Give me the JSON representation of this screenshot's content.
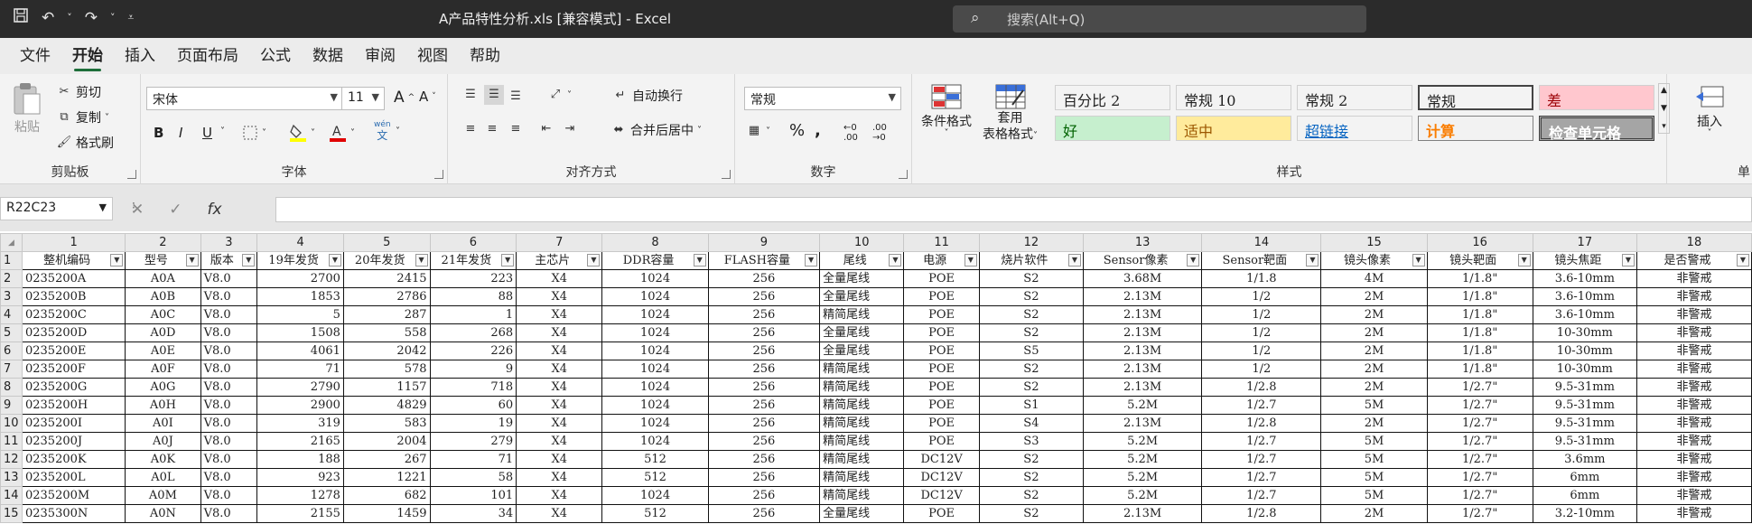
{
  "app": {
    "title": "A产品特性分析.xls  [兼容模式]  -  Excel",
    "search_placeholder": "搜索(Alt+Q)"
  },
  "menu": [
    "文件",
    "开始",
    "插入",
    "页面布局",
    "公式",
    "数据",
    "审阅",
    "视图",
    "帮助"
  ],
  "ribbon": {
    "clipboard": {
      "label": "剪贴板",
      "paste": "粘贴",
      "cut": "剪切",
      "copy": "复制",
      "format_painter": "格式刷"
    },
    "font": {
      "label": "字体",
      "family": "宋体",
      "size": "11",
      "grow": "A^",
      "shrink": "A˅",
      "bold": "B",
      "italic": "I",
      "underline": "U",
      "wen": "wén",
      "wen2": "文"
    },
    "alignment": {
      "label": "对齐方式",
      "wrap": "自动换行",
      "merge": "合并后居中"
    },
    "number": {
      "label": "数字",
      "format": "常规"
    },
    "styles": {
      "label": "样式",
      "conditional": "条件格式",
      "table1": "套用",
      "table2": "表格格式",
      "cells": [
        {
          "text": "百分比 2",
          "bg": "#ffffff",
          "color": "#000000"
        },
        {
          "text": "常规 10",
          "bg": "#ffffff",
          "color": "#000000"
        },
        {
          "text": "常规 2",
          "bg": "#ffffff",
          "color": "#000000"
        },
        {
          "text": "常规",
          "bg": "#ffffff",
          "color": "#000000"
        },
        {
          "text": "差",
          "bg": "#ffc7ce",
          "color": "#9c0006"
        },
        {
          "text": "好",
          "bg": "#c6efce",
          "color": "#006100"
        },
        {
          "text": "适中",
          "bg": "#ffeb9c",
          "color": "#9c5700"
        },
        {
          "text": "超链接",
          "bg": "#ffffff",
          "color": "#0563c1"
        },
        {
          "text": "计算",
          "bg": "#f2f2f2",
          "color": "#fa7d00"
        },
        {
          "text": "检查单元格",
          "bg": "#a5a5a5",
          "color": "#ffffff"
        }
      ]
    },
    "cells_group": {
      "insert": "插入",
      "label": "单"
    }
  },
  "formula_bar": {
    "name_box": "R22C23",
    "fx": "fx",
    "value": ""
  },
  "sheet": {
    "col_numbers": [
      "1",
      "2",
      "3",
      "4",
      "5",
      "6",
      "7",
      "8",
      "9",
      "10",
      "11",
      "12",
      "13",
      "14",
      "15",
      "16",
      "17",
      "18"
    ],
    "headers": [
      "整机编码",
      "型号",
      "版本",
      "19年发货",
      "20年发货",
      "21年发货",
      "主芯片",
      "DDR容量",
      "FLASH容量",
      "尾线",
      "电源",
      "烧片软件",
      "Sensor像素",
      "Sensor靶面",
      "镜头像素",
      "镜头靶面",
      "镜头焦距",
      "是否警戒"
    ],
    "rows": [
      [
        "0235200A",
        "A0A",
        "V8.0",
        "2700",
        "2415",
        "223",
        "X4",
        "1024",
        "256",
        "全量尾线",
        "POE",
        "S2",
        "3.68M",
        "1/1.8",
        "4M",
        "1/1.8\"",
        "3.6-10mm",
        "非警戒"
      ],
      [
        "0235200B",
        "A0B",
        "V8.0",
        "1853",
        "2786",
        "88",
        "X4",
        "1024",
        "256",
        "全量尾线",
        "POE",
        "S2",
        "2.13M",
        "1/2",
        "2M",
        "1/1.8\"",
        "3.6-10mm",
        "非警戒"
      ],
      [
        "0235200C",
        "A0C",
        "V8.0",
        "5",
        "287",
        "1",
        "X4",
        "1024",
        "256",
        "精简尾线",
        "POE",
        "S2",
        "2.13M",
        "1/2",
        "2M",
        "1/1.8\"",
        "3.6-10mm",
        "非警戒"
      ],
      [
        "0235200D",
        "A0D",
        "V8.0",
        "1508",
        "558",
        "268",
        "X4",
        "1024",
        "256",
        "全量尾线",
        "POE",
        "S2",
        "2.13M",
        "1/2",
        "2M",
        "1/1.8\"",
        "10-30mm",
        "非警戒"
      ],
      [
        "0235200E",
        "A0E",
        "V8.0",
        "4061",
        "2042",
        "226",
        "X4",
        "1024",
        "256",
        "全量尾线",
        "POE",
        "S5",
        "2.13M",
        "1/2",
        "2M",
        "1/1.8\"",
        "10-30mm",
        "非警戒"
      ],
      [
        "0235200F",
        "A0F",
        "V8.0",
        "71",
        "578",
        "9",
        "X4",
        "1024",
        "256",
        "精简尾线",
        "POE",
        "S2",
        "2.13M",
        "1/2",
        "2M",
        "1/1.8\"",
        "10-30mm",
        "非警戒"
      ],
      [
        "0235200G",
        "A0G",
        "V8.0",
        "2790",
        "1157",
        "718",
        "X4",
        "1024",
        "256",
        "精简尾线",
        "POE",
        "S2",
        "2.13M",
        "1/2.8",
        "2M",
        "1/2.7\"",
        "9.5-31mm",
        "非警戒"
      ],
      [
        "0235200H",
        "A0H",
        "V8.0",
        "2900",
        "4829",
        "60",
        "X4",
        "1024",
        "256",
        "精简尾线",
        "POE",
        "S1",
        "5.2M",
        "1/2.7",
        "5M",
        "1/2.7\"",
        "9.5-31mm",
        "非警戒"
      ],
      [
        "0235200I",
        "A0I",
        "V8.0",
        "319",
        "583",
        "19",
        "X4",
        "1024",
        "256",
        "精简尾线",
        "POE",
        "S4",
        "2.13M",
        "1/2.8",
        "2M",
        "1/2.7\"",
        "9.5-31mm",
        "非警戒"
      ],
      [
        "0235200J",
        "A0J",
        "V8.0",
        "2165",
        "2004",
        "279",
        "X4",
        "1024",
        "256",
        "精简尾线",
        "POE",
        "S3",
        "5.2M",
        "1/2.7",
        "5M",
        "1/2.7\"",
        "9.5-31mm",
        "非警戒"
      ],
      [
        "0235200K",
        "A0K",
        "V8.0",
        "188",
        "267",
        "71",
        "X4",
        "512",
        "256",
        "精简尾线",
        "DC12V",
        "S2",
        "5.2M",
        "1/2.7",
        "5M",
        "1/2.7\"",
        "3.6mm",
        "非警戒"
      ],
      [
        "0235200L",
        "A0L",
        "V8.0",
        "923",
        "1221",
        "58",
        "X4",
        "512",
        "256",
        "精简尾线",
        "DC12V",
        "S2",
        "5.2M",
        "1/2.7",
        "5M",
        "1/2.7\"",
        "6mm",
        "非警戒"
      ],
      [
        "0235200M",
        "A0M",
        "V8.0",
        "1278",
        "682",
        "101",
        "X4",
        "1024",
        "256",
        "精简尾线",
        "DC12V",
        "S2",
        "5.2M",
        "1/2.7",
        "5M",
        "1/2.7\"",
        "6mm",
        "非警戒"
      ],
      [
        "0235300N",
        "A0N",
        "V8.0",
        "2155",
        "1459",
        "34",
        "X4",
        "512",
        "256",
        "全量尾线",
        "POE",
        "S2",
        "2.13M",
        "1/2.8",
        "2M",
        "1/2.7\"",
        "3.2-10mm",
        "非警戒"
      ]
    ]
  }
}
